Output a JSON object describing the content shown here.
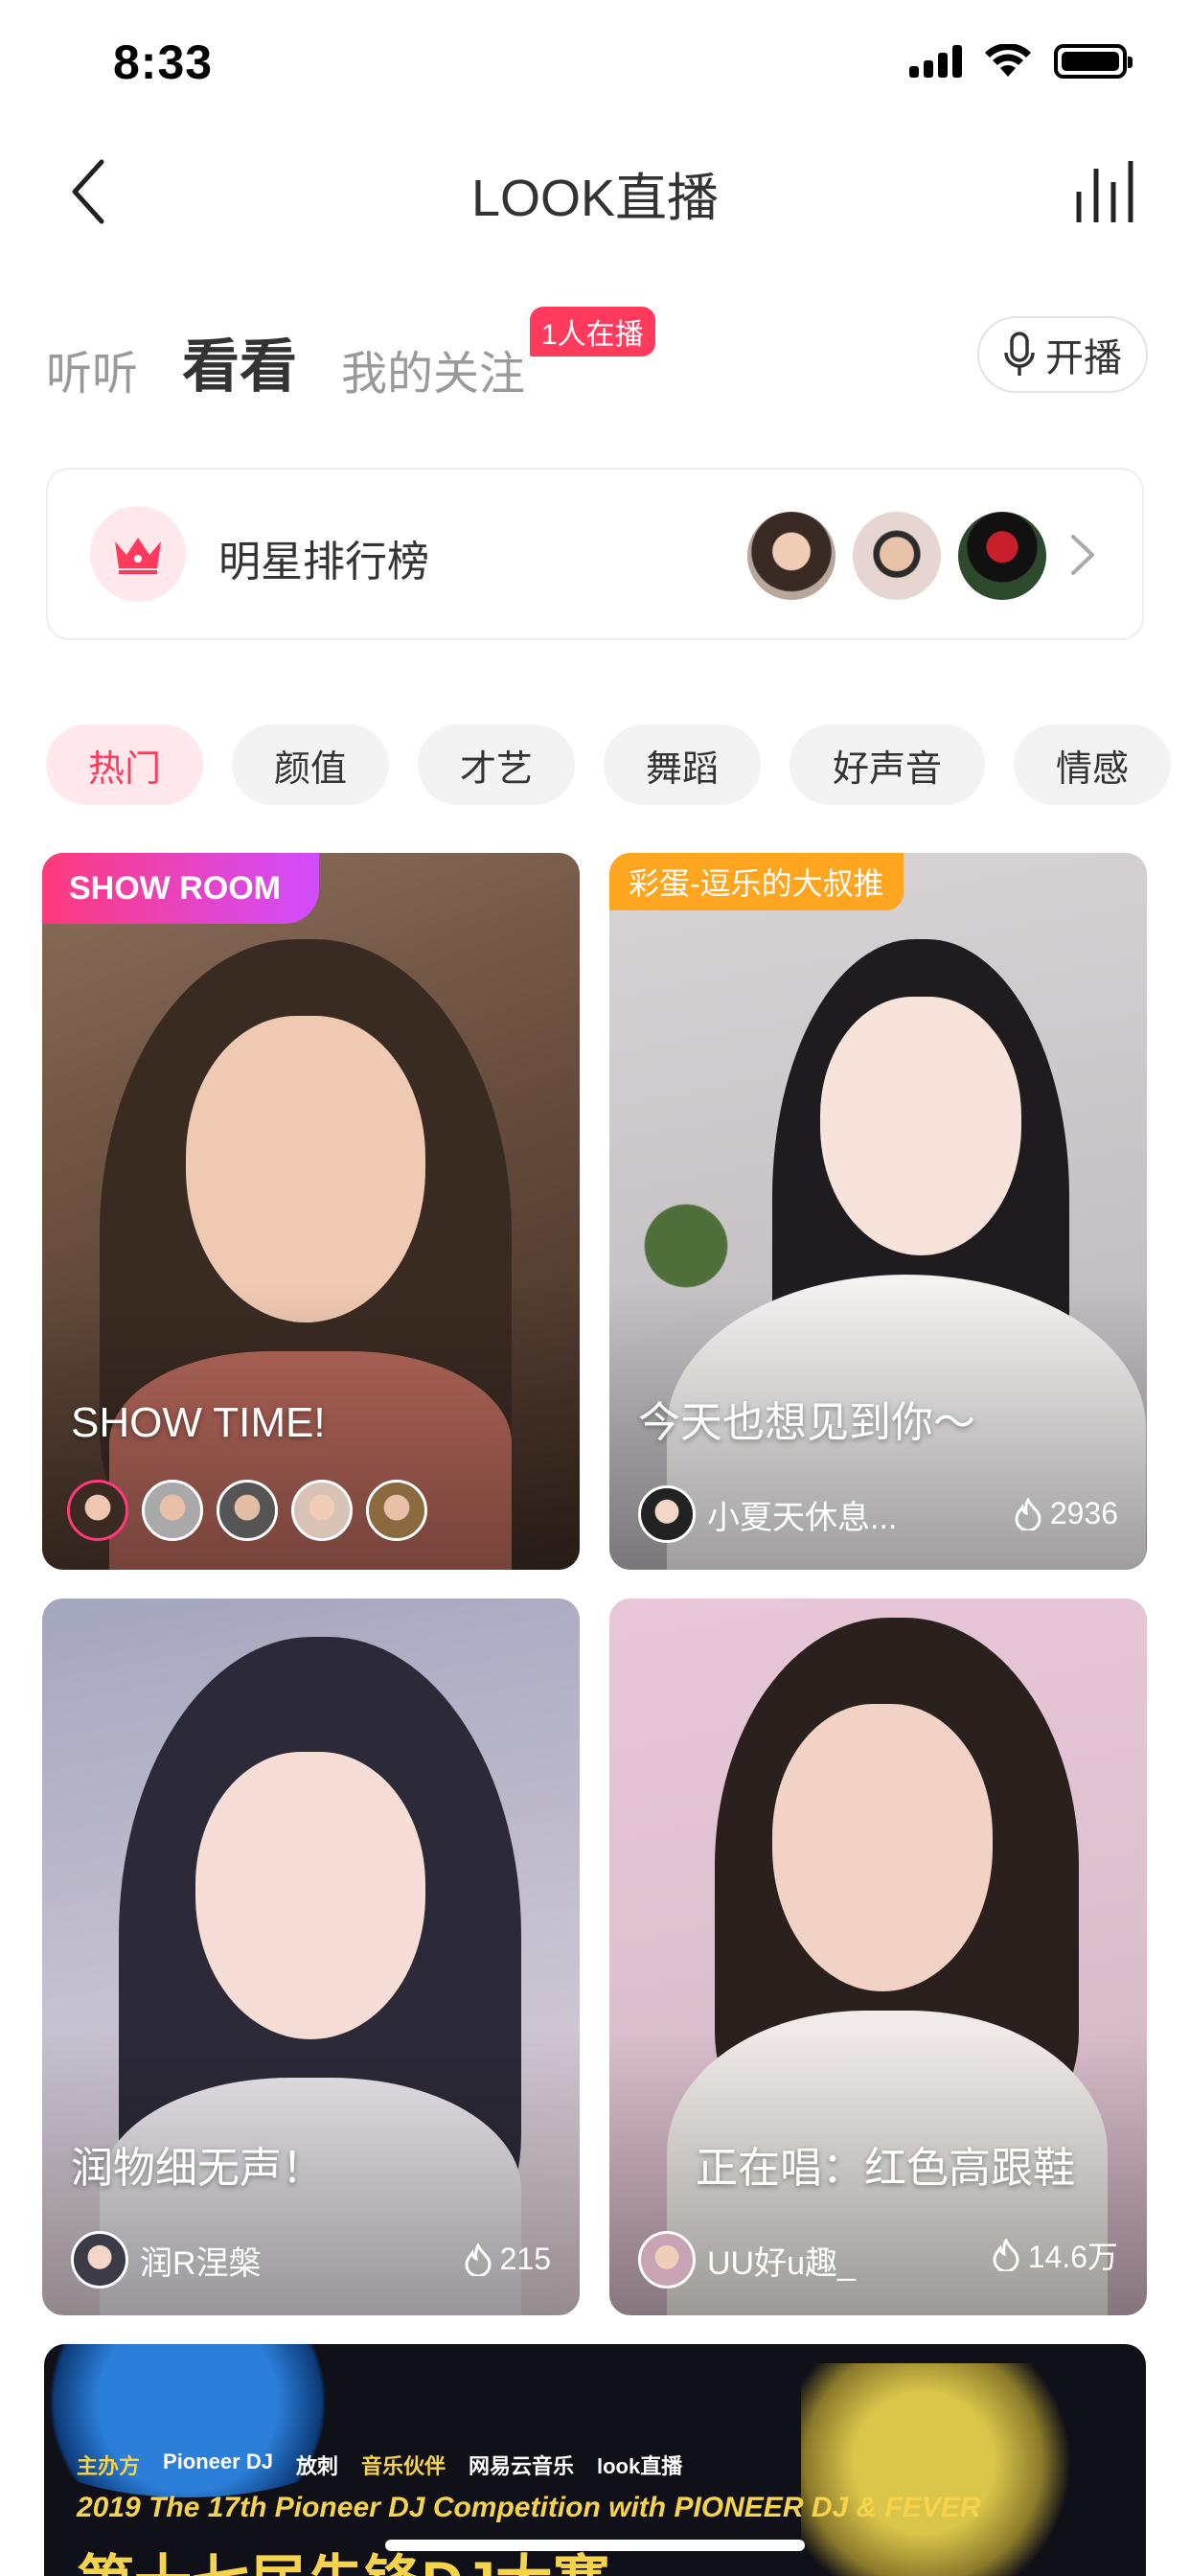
{
  "status_bar": {
    "time": "8:33"
  },
  "nav": {
    "title": "LOOK直播"
  },
  "tabs": {
    "listen": "听听",
    "watch": "看看",
    "following": "我的关注",
    "following_badge": "1人在播",
    "broadcast_label": "开播"
  },
  "ranking": {
    "title": "明星排行榜"
  },
  "categories": [
    {
      "label": "热门",
      "active": true
    },
    {
      "label": "颜值",
      "active": false
    },
    {
      "label": "才艺",
      "active": false
    },
    {
      "label": "舞蹈",
      "active": false
    },
    {
      "label": "好声音",
      "active": false
    },
    {
      "label": "情感",
      "active": false
    }
  ],
  "cards": [
    {
      "tag": "SHOW ROOM",
      "caption": "SHOW TIME!"
    },
    {
      "tag": "彩蛋-逗乐的大叔推",
      "caption": "今天也想见到你～",
      "user": "小夏天休息...",
      "heat": "2936"
    },
    {
      "caption": "润物细无声！",
      "user": "润R涅槃",
      "heat": "215"
    },
    {
      "caption": "正在唱：红色高跟鞋",
      "user": "UU好u趣_",
      "heat": "14.6万"
    }
  ],
  "banner": {
    "organizer_label": "主办方",
    "organizer_brand": "Pioneer DJ",
    "organizer_brand2": "放刺",
    "partner_label": "音乐伙伴",
    "partner_1": "网易云音乐",
    "partner_2": "look直播",
    "headline": "2019 The 17th Pioneer DJ Competition with PIONEER DJ & FEVER",
    "big_text": "第十七届先锋DJ大赛"
  },
  "colors": {
    "accent": "#ff3a5c",
    "tag_orange": "#ffa51f"
  }
}
